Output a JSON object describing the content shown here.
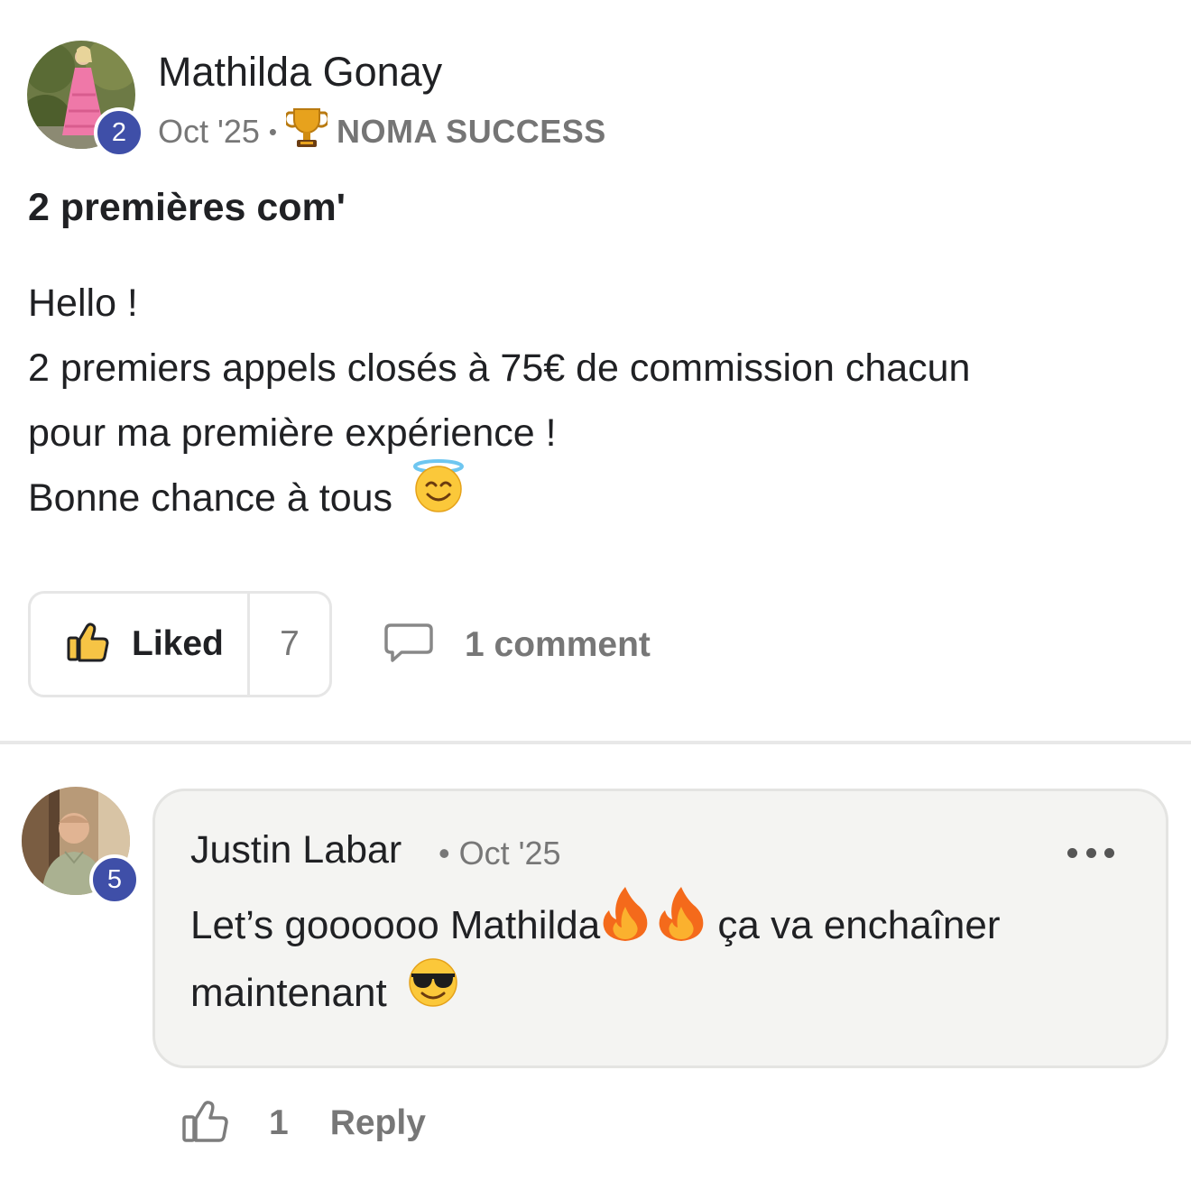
{
  "post": {
    "author": {
      "name": "Mathilda Gonay",
      "level": "2",
      "avatar_icon": "user-avatar-photo"
    },
    "date": "Oct '25",
    "separator": "•",
    "category": {
      "icon": "trophy-icon",
      "label": "NOMA SUCCESS"
    },
    "title": "2 premières com'",
    "body": {
      "line1": "Hello !",
      "line2": "2 premiers appels closés à 75€ de commission chacun",
      "line3": "pour ma première expérience !",
      "line4": "Bonne chance à tous",
      "line4_emoji": "smiling-face-with-halo"
    },
    "like_label": "Liked",
    "like_count": "7",
    "comments_label": "1 comment"
  },
  "comment": {
    "author": {
      "name": "Justin Labar",
      "level": "5"
    },
    "meta": "• Oct '25",
    "body": {
      "part1": "Let’s goooooo Mathilda",
      "part2": " ça va enchaîner",
      "line2": "maintenant",
      "emojis": [
        "fire",
        "fire",
        "smiling-face-with-sunglasses"
      ]
    },
    "like_count": "1",
    "reply_label": "Reply"
  },
  "colors": {
    "badge": "#3f4fa8",
    "muted_text": "#777777",
    "bubble_bg": "#f4f4f2",
    "border": "#e6e6e6"
  }
}
